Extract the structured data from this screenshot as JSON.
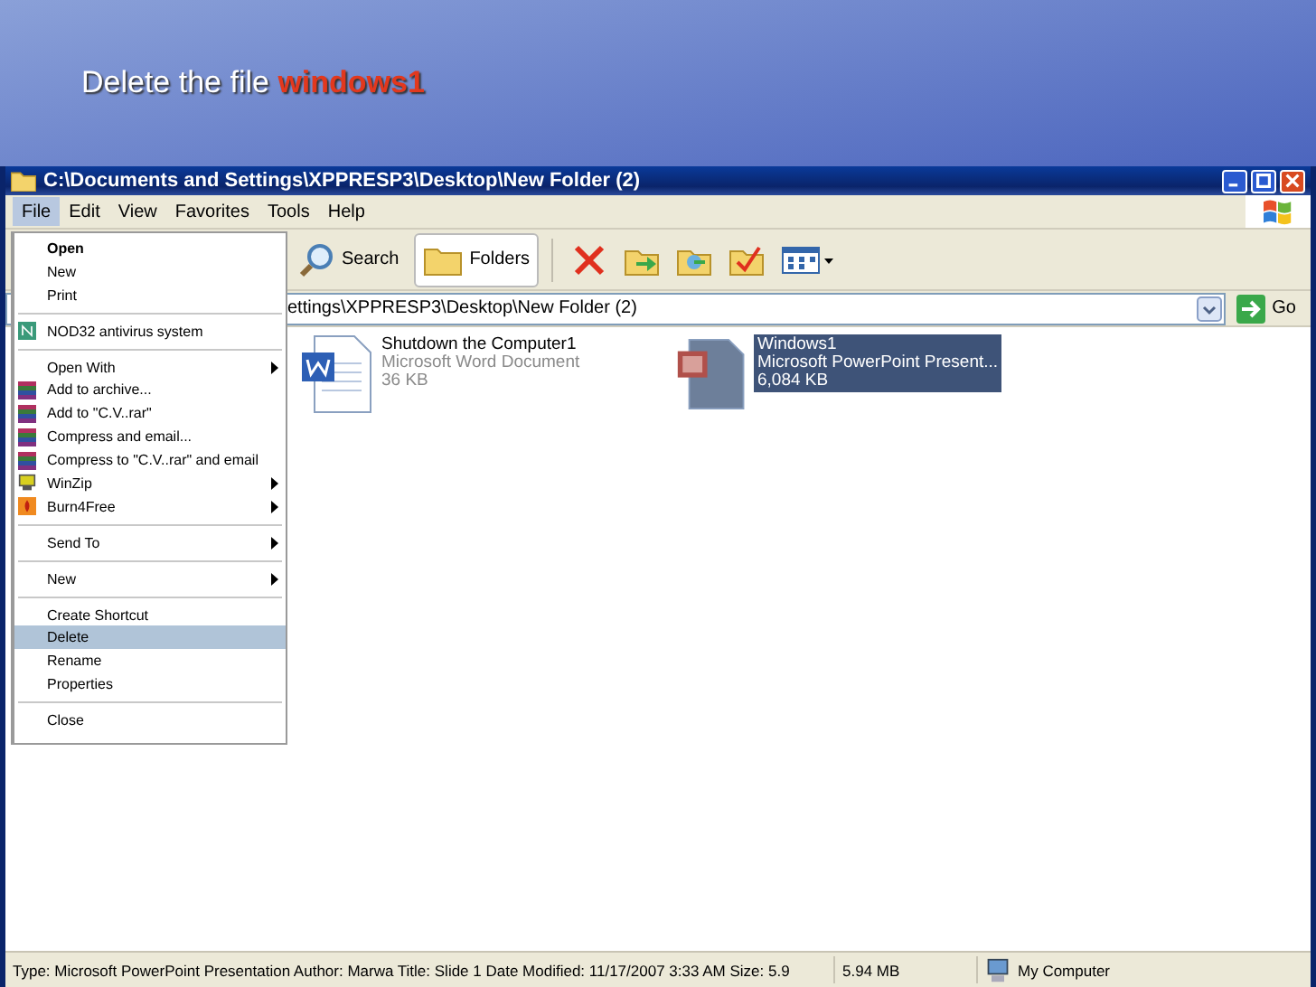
{
  "slide_title": "Delete the file **windows1**",
  "window": {
    "title": "C:\\Documents and Settings\\XPPRESP3\\Desktop\\New Folder (2)"
  },
  "menu_bar": [
    {
      "label": "File",
      "selected": true
    },
    {
      "label": "Edit",
      "selected": false
    },
    {
      "label": "View",
      "selected": false
    },
    {
      "label": "Favorites",
      "selected": false
    },
    {
      "label": "Tools",
      "selected": false
    },
    {
      "label": "Help",
      "selected": false
    }
  ],
  "file_menu": [
    {
      "kind": "plain",
      "label": "Open",
      "default": true,
      "submenu": false,
      "selected": false
    },
    {
      "kind": "plain",
      "label": "New",
      "default": false,
      "submenu": false,
      "selected": false
    },
    {
      "kind": "plain",
      "label": "Print",
      "default": false,
      "submenu": false,
      "selected": false
    },
    {
      "kind": "separator"
    },
    {
      "kind": "antivirus",
      "label": "NOD32 antivirus system",
      "default": false,
      "submenu": false,
      "selected": false
    },
    {
      "kind": "separator"
    },
    {
      "kind": "plain",
      "label": "Open With",
      "default": false,
      "submenu": true,
      "selected": false
    },
    {
      "kind": "archive",
      "label": "Add to archive...",
      "default": false,
      "submenu": false,
      "selected": false
    },
    {
      "kind": "archive",
      "label": "Add to \"C.V..rar\"",
      "default": false,
      "submenu": false,
      "selected": false
    },
    {
      "kind": "archive",
      "label": "Compress and email...",
      "default": false,
      "submenu": false,
      "selected": false
    },
    {
      "kind": "archive",
      "label": "Compress to \"C.V..rar\" and email",
      "default": false,
      "submenu": false,
      "selected": false
    },
    {
      "kind": "zip",
      "label": "WinZip",
      "default": false,
      "submenu": true,
      "selected": false
    },
    {
      "kind": "burn",
      "label": "Burn4Free",
      "default": false,
      "submenu": true,
      "selected": false
    },
    {
      "kind": "separator"
    },
    {
      "kind": "plain",
      "label": "Send To",
      "default": false,
      "submenu": true,
      "selected": false
    },
    {
      "kind": "separator"
    },
    {
      "kind": "plain",
      "label": "New",
      "default": false,
      "submenu": true,
      "selected": false
    },
    {
      "kind": "separator"
    },
    {
      "kind": "plain",
      "label": "Create Shortcut",
      "default": false,
      "submenu": false,
      "selected": false
    },
    {
      "kind": "plain",
      "label": "Delete",
      "default": false,
      "submenu": false,
      "selected": true
    },
    {
      "kind": "plain",
      "label": "Rename",
      "default": false,
      "submenu": false,
      "selected": false
    },
    {
      "kind": "plain",
      "label": "Properties",
      "default": false,
      "submenu": false,
      "selected": false
    },
    {
      "kind": "separator"
    },
    {
      "kind": "plain",
      "label": "Close",
      "default": false,
      "submenu": false,
      "selected": false
    }
  ],
  "toolbar": {
    "search": "Search",
    "folders": "Folders"
  },
  "address": {
    "value": "ettings\\XPPRESP3\\Desktop\\New Folder (2)",
    "go": "Go"
  },
  "files": [
    {
      "kind": "word",
      "name": "Shutdown the Computer1",
      "type": "Microsoft Word Document",
      "size": "36 KB",
      "selected": false
    },
    {
      "kind": "powerpoint",
      "name": "Windows1",
      "type": "Microsoft PowerPoint Present...",
      "size": "6,084 KB",
      "selected": true
    }
  ],
  "status_bar": {
    "info": "Type: Microsoft PowerPoint Presentation Author: Marwa Title: Slide 1 Date Modified: 11/17/2007 3:33 AM Size: 5.9",
    "size": "5.94 MB",
    "zone": "My Computer"
  }
}
